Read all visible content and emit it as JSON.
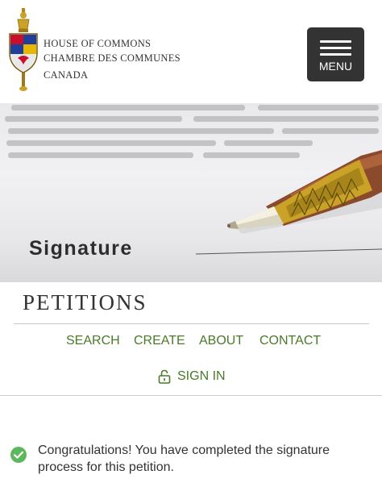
{
  "header": {
    "org_line1": "HOUSE OF COMMONS",
    "org_line2": "CHAMBRE DES COMMUNES",
    "org_line3": "CANADA",
    "crest_icon": "house-of-commons-mace-crest",
    "menu_label": "MENU",
    "menu_icon": "hamburger-icon"
  },
  "banner": {
    "signature_word": "Signature",
    "image": "pen-signing-document"
  },
  "petitions": {
    "title": "PETITIONS",
    "nav": [
      "SEARCH",
      "CREATE",
      "ABOUT",
      "CONTACT"
    ],
    "sign_in": "SIGN IN",
    "sign_in_icon": "unlock-icon"
  },
  "message": {
    "icon": "check-circle-icon",
    "text": "Congratulations! You have completed the signature process for this petition."
  },
  "colors": {
    "accent_green": "#4a7a2a",
    "success_green": "#5cb85c",
    "menu_bg": "#333333"
  }
}
